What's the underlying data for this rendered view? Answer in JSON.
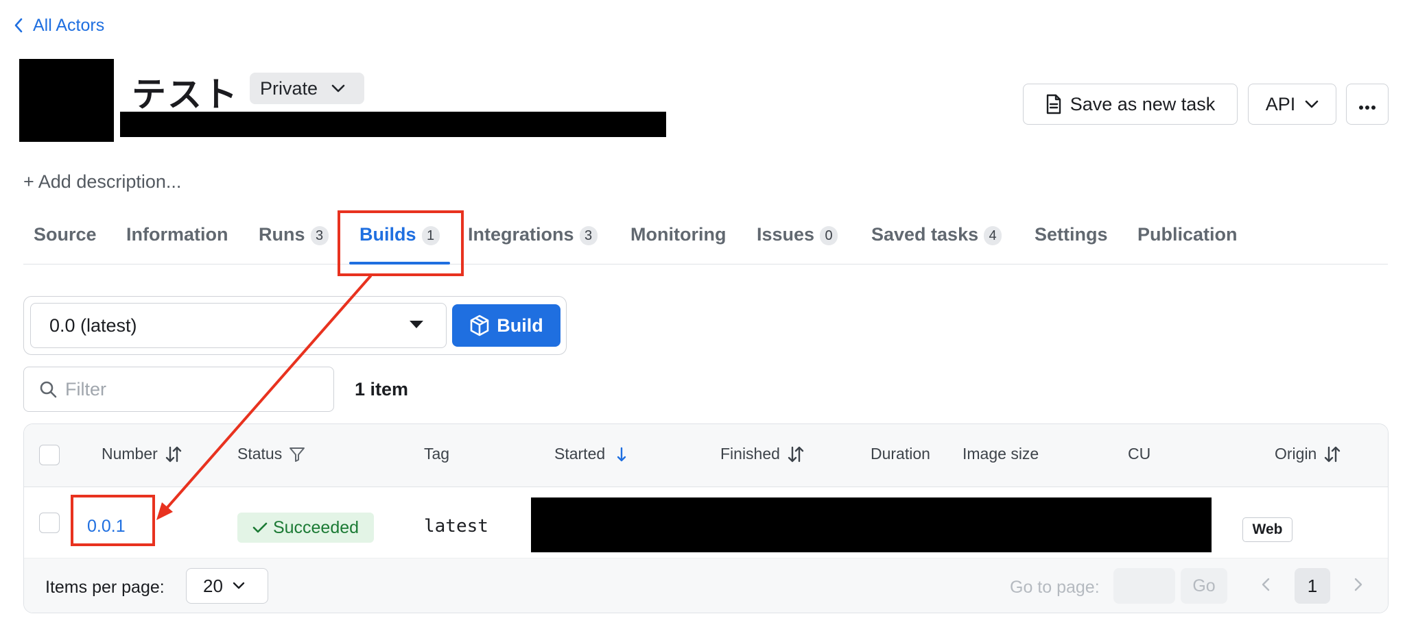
{
  "nav": {
    "back_label": "All Actors"
  },
  "actor": {
    "title": "テスト",
    "privacy": "Private"
  },
  "header_actions": {
    "save_task_label": "Save as new task",
    "api_label": "API"
  },
  "description": {
    "add_label": "+ Add description..."
  },
  "tabs": [
    {
      "label": "Source",
      "count": null
    },
    {
      "label": "Information",
      "count": null
    },
    {
      "label": "Runs",
      "count": "3"
    },
    {
      "label": "Builds",
      "count": "1",
      "active": true
    },
    {
      "label": "Integrations",
      "count": "3"
    },
    {
      "label": "Monitoring",
      "count": null
    },
    {
      "label": "Issues",
      "count": "0"
    },
    {
      "label": "Saved tasks",
      "count": "4"
    },
    {
      "label": "Settings",
      "count": null
    },
    {
      "label": "Publication",
      "count": null
    }
  ],
  "build_controls": {
    "version": "0.0 (latest)",
    "build_label": "Build"
  },
  "filter": {
    "placeholder": "Filter",
    "value": "",
    "item_count": "1 item"
  },
  "table": {
    "columns": [
      "Number",
      "Status",
      "Tag",
      "Started",
      "Finished",
      "Duration",
      "Image size",
      "CU",
      "Origin"
    ],
    "rows": [
      {
        "number": "0.0.1",
        "status": "Succeeded",
        "tag": "latest",
        "origin": "Web"
      }
    ]
  },
  "pagination": {
    "items_per_page_label": "Items per page:",
    "items_per_page": "20",
    "goto_label": "Go to page:",
    "go_label": "Go",
    "current_page": "1"
  },
  "colors": {
    "accent": "#1f6fe0",
    "success_bg": "#e3f4e6",
    "success_text": "#1b7a34",
    "annotation": "#e8321f"
  },
  "icons": {
    "back": "chevron-left-icon",
    "privacy_caret": "chevron-down-icon",
    "save_task": "document-icon",
    "api_caret": "chevron-down-icon",
    "more": "ellipsis-icon",
    "build": "cube-icon",
    "filter": "search-icon",
    "status_filter": "funnel-icon",
    "sort": "sort-icon",
    "sort_desc": "arrow-down-icon",
    "status_ok": "check-icon"
  }
}
